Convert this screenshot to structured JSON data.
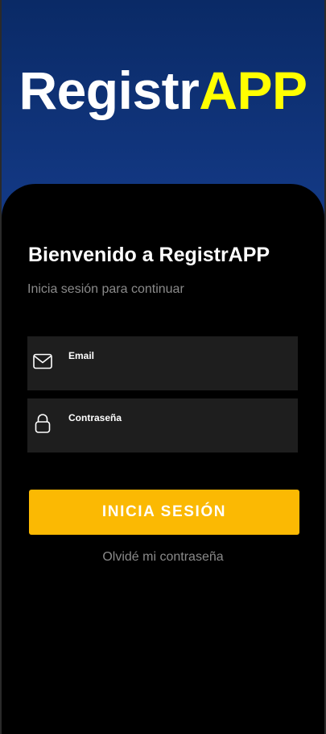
{
  "logo": {
    "part1": "Registr",
    "part2": "APP"
  },
  "login": {
    "title": "Bienvenido a RegistrAPP",
    "subtitle": "Inicia sesión para continuar",
    "email_label": "Email",
    "email_value": "",
    "email_icon": "mail-icon",
    "password_label": "Contraseña",
    "password_value": "",
    "password_icon": "lock-icon",
    "submit_label": "INICIA SESIÓN",
    "forgot_label": "Olvidé mi contraseña"
  },
  "colors": {
    "header_gradient_top": "#0a2a66",
    "header_gradient_bottom": "#2858c0",
    "logo_accent": "#ffff00",
    "card_background": "#000000",
    "field_background": "#1e1e1e",
    "button_background": "#fbb903",
    "muted_text": "#8a8a8a"
  }
}
